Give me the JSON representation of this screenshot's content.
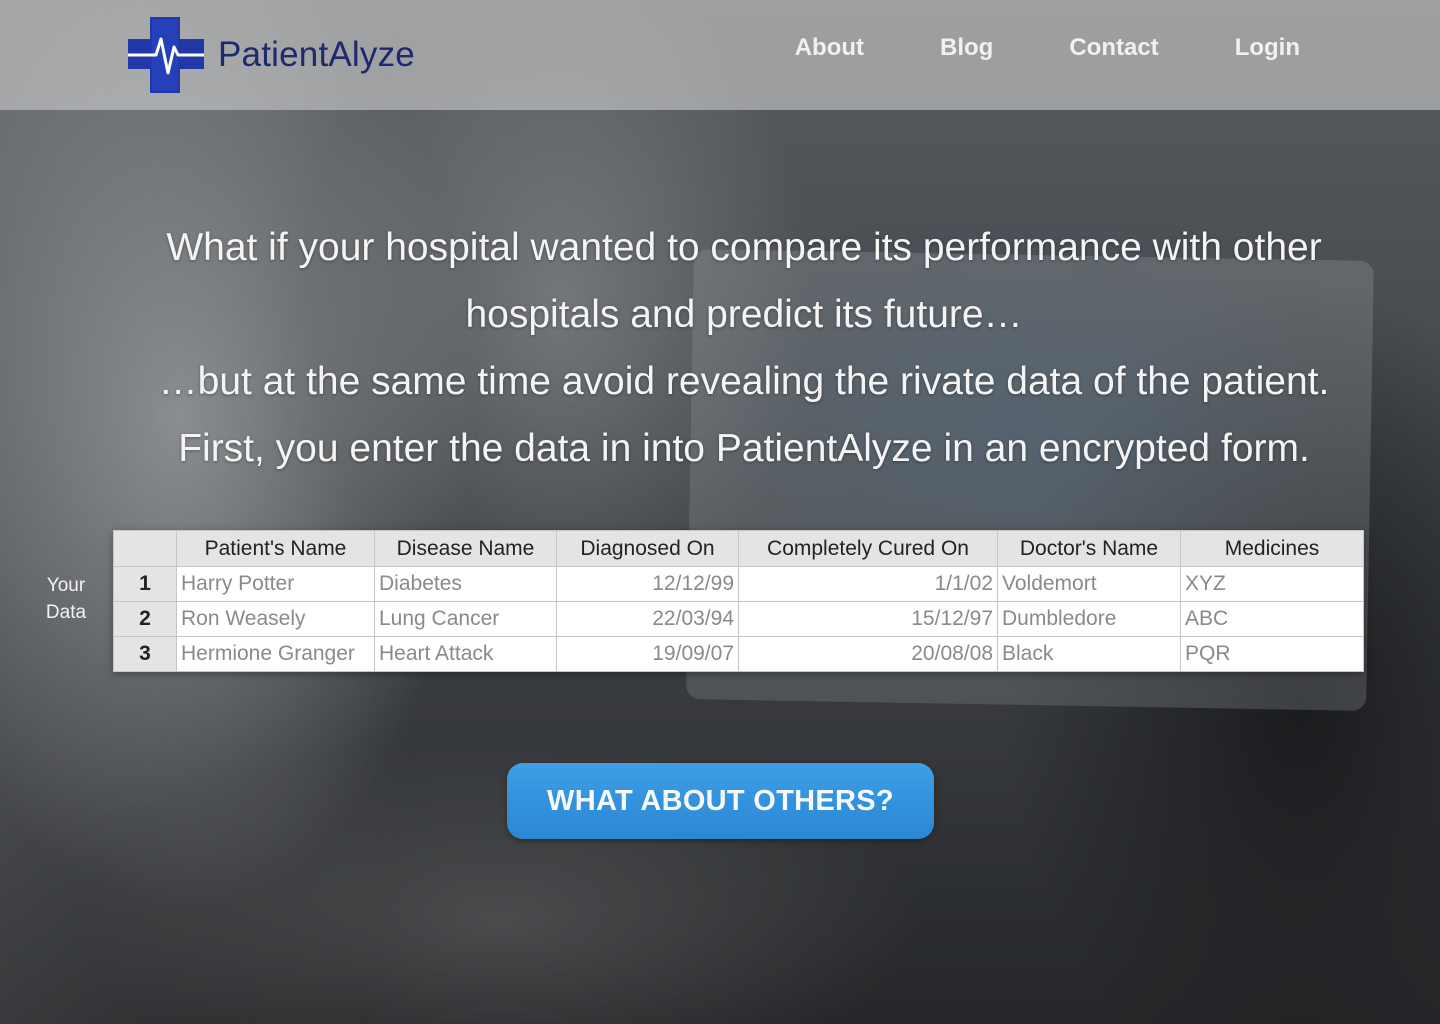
{
  "header": {
    "brand": "PatientAlyze",
    "nav": [
      {
        "label": "About"
      },
      {
        "label": "Blog"
      },
      {
        "label": "Contact"
      },
      {
        "label": "Login"
      }
    ]
  },
  "hero": {
    "line1": "What if your hospital wanted to compare its performance with other",
    "line2": "hospitals and predict its future…",
    "line3": "…but at the same time avoid revealing the rivate data of the patient.",
    "line4": "First, you enter the data in into PatientAlyze in an encrypted form."
  },
  "side_label": {
    "line1": "Your",
    "line2": "Data"
  },
  "table": {
    "columns": [
      "Patient's Name",
      "Disease Name",
      "Diagnosed On",
      "Completely Cured On",
      "Doctor's Name",
      "Medicines"
    ],
    "rows": [
      {
        "no": "1",
        "patient": "Harry Potter",
        "disease": "Diabetes",
        "diagnosed": "12/12/99",
        "cured": "1/1/02",
        "doctor": "Voldemort",
        "medicines": "XYZ"
      },
      {
        "no": "2",
        "patient": "Ron Weasely",
        "disease": "Lung Cancer",
        "diagnosed": "22/03/94",
        "cured": "15/12/97",
        "doctor": "Dumbledore",
        "medicines": "ABC"
      },
      {
        "no": "3",
        "patient": "Hermione Granger",
        "disease": "Heart Attack",
        "diagnosed": "19/09/07",
        "cured": "20/08/08",
        "doctor": "Black",
        "medicines": "PQR"
      }
    ]
  },
  "cta": {
    "label": "WHAT ABOUT OTHERS?"
  },
  "colors": {
    "brand": "#1d2a6b",
    "logo_blue": "#2238a8",
    "cta_blue": "#3498e0"
  },
  "icons": {
    "logo": "medical-cross-heartbeat-icon"
  }
}
